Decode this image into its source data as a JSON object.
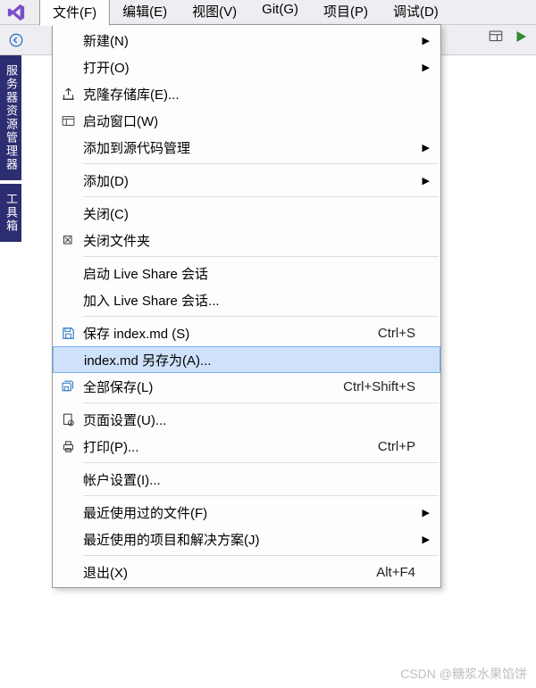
{
  "menubar": {
    "items": [
      {
        "label": "文件(F)",
        "active": true
      },
      {
        "label": "编辑(E)"
      },
      {
        "label": "视图(V)"
      },
      {
        "label": "Git(G)"
      },
      {
        "label": "项目(P)"
      },
      {
        "label": "调试(D)"
      }
    ]
  },
  "side_tabs": [
    "服务器资源管理器",
    "工具箱"
  ],
  "file_menu": [
    {
      "type": "item",
      "label": "新建(N)",
      "icon": null,
      "submenu": true
    },
    {
      "type": "item",
      "label": "打开(O)",
      "icon": null,
      "submenu": true
    },
    {
      "type": "item",
      "label": "克隆存储库(E)...",
      "icon": "clone"
    },
    {
      "type": "item",
      "label": "启动窗口(W)",
      "icon": "window"
    },
    {
      "type": "item",
      "label": "添加到源代码管理",
      "icon": null,
      "submenu": true
    },
    {
      "type": "sep"
    },
    {
      "type": "item",
      "label": "添加(D)",
      "icon": null,
      "submenu": true
    },
    {
      "type": "sep"
    },
    {
      "type": "item",
      "label": "关闭(C)",
      "icon": null
    },
    {
      "type": "item",
      "label": "关闭文件夹",
      "icon": "close-folder"
    },
    {
      "type": "sep"
    },
    {
      "type": "item",
      "label": "启动 Live Share 会话",
      "icon": null
    },
    {
      "type": "item",
      "label": "加入 Live Share 会话...",
      "icon": null
    },
    {
      "type": "sep"
    },
    {
      "type": "item",
      "label": "保存 index.md (S)",
      "icon": "save",
      "shortcut": "Ctrl+S"
    },
    {
      "type": "item",
      "label": "index.md 另存为(A)...",
      "icon": null,
      "highlighted": true
    },
    {
      "type": "item",
      "label": "全部保存(L)",
      "icon": "save-all",
      "shortcut": "Ctrl+Shift+S"
    },
    {
      "type": "sep"
    },
    {
      "type": "item",
      "label": "页面设置(U)...",
      "icon": "page-setup"
    },
    {
      "type": "item",
      "label": "打印(P)...",
      "icon": "print",
      "shortcut": "Ctrl+P"
    },
    {
      "type": "sep"
    },
    {
      "type": "item",
      "label": "帐户设置(I)...",
      "icon": null
    },
    {
      "type": "sep"
    },
    {
      "type": "item",
      "label": "最近使用过的文件(F)",
      "icon": null,
      "submenu": true
    },
    {
      "type": "item",
      "label": "最近使用的项目和解决方案(J)",
      "icon": null,
      "submenu": true
    },
    {
      "type": "sep"
    },
    {
      "type": "item",
      "label": "退出(X)",
      "icon": null,
      "shortcut": "Alt+F4"
    }
  ],
  "watermark": "CSDN @糖浆水果馅饼"
}
